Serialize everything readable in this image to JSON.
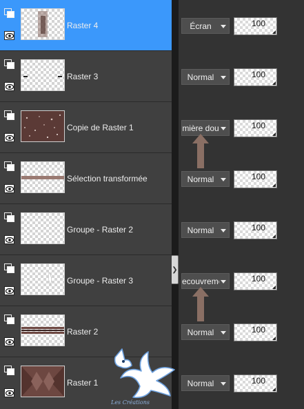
{
  "layers": [
    {
      "name": "Raster 4",
      "selected": true,
      "blend_mode": "Écran",
      "opacity": "100"
    },
    {
      "name": "Raster 3",
      "selected": false,
      "blend_mode": "Normal",
      "opacity": "100"
    },
    {
      "name": "Copie de Raster 1",
      "selected": false,
      "blend_mode": "mière dou",
      "opacity": "100"
    },
    {
      "name": "Sélection transformée",
      "selected": false,
      "blend_mode": "Normal",
      "opacity": "100"
    },
    {
      "name": "Groupe - Raster 2",
      "selected": false,
      "blend_mode": "Normal",
      "opacity": "100"
    },
    {
      "name": "Groupe - Raster 3",
      "selected": false,
      "blend_mode": "ecouvreme",
      "opacity": "100"
    },
    {
      "name": "Raster 2",
      "selected": false,
      "blend_mode": "Normal",
      "opacity": "100"
    },
    {
      "name": "Raster 1",
      "selected": false,
      "blend_mode": "Normal",
      "opacity": "100"
    }
  ],
  "watermark": {
    "text": "Les Créations"
  },
  "colors": {
    "selected_row": "#3b98fb",
    "panel_bg": "#404040",
    "annotation_arrow": "#8a6f64",
    "thumb_brown": "#6d4741"
  },
  "icons": {
    "group": "group-icon",
    "visibility": "eye-icon",
    "dropdown": "chevron-down-icon",
    "splitter": "splitter-grip-icon",
    "annotation": "up-arrow-icon"
  }
}
